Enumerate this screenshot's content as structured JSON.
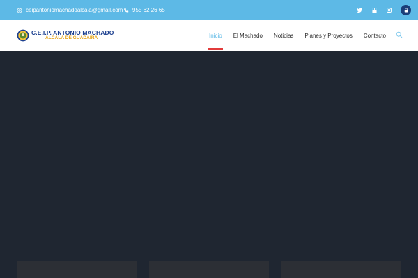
{
  "topbar": {
    "email": "ceipantoniomachadoalcala@gmail.com",
    "phone": "955 62 26 65"
  },
  "logo": {
    "title": "C.E.I.P. ANTONIO MACHADO",
    "subtitle": "ALCALA DE GUADAIRA"
  },
  "nav": {
    "items": [
      {
        "label": "Inicio",
        "active": true
      },
      {
        "label": "El Machado"
      },
      {
        "label": "Noticias"
      },
      {
        "label": "Planes y Proyectos"
      },
      {
        "label": "Contacto"
      }
    ]
  },
  "colors": {
    "topbar": "#5db9e6",
    "active_nav": "#5db9e6",
    "active_underline": "#e23b3b",
    "hero_background": "#1f2631",
    "account_button": "#1a3d78"
  },
  "icons": [
    "email-icon",
    "phone-icon",
    "twitter-icon",
    "youtube-icon",
    "instagram-icon",
    "user-icon",
    "search-icon"
  ]
}
